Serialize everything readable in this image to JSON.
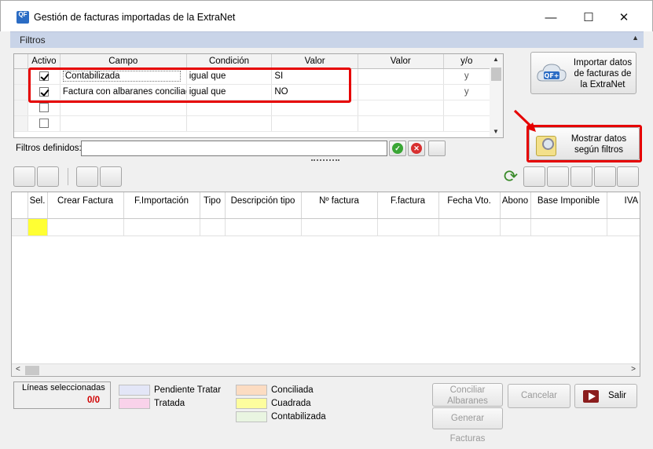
{
  "window": {
    "app_icon": "QF",
    "title": "Gestión de facturas importadas de la ExtraNet",
    "controls": {
      "minimize": "—",
      "maximize": "☐",
      "close": "✕"
    }
  },
  "filters_panel": {
    "label": "Filtros",
    "columns": [
      "Activo",
      "Campo",
      "Condición",
      "Valor",
      "Valor",
      "y/o"
    ],
    "rows": [
      {
        "active": true,
        "field": "Contabilizada",
        "condition": "igual que",
        "value1": "SI",
        "value2": "",
        "andor": "y"
      },
      {
        "active": true,
        "field": "Factura con albaranes conciliados",
        "condition": "igual que",
        "value1": "NO",
        "value2": "",
        "andor": "y"
      },
      {
        "active": false,
        "field": "",
        "condition": "",
        "value1": "",
        "value2": "",
        "andor": ""
      },
      {
        "active": false,
        "field": "",
        "condition": "",
        "value1": "",
        "value2": "",
        "andor": ""
      },
      {
        "active": false,
        "field": "",
        "condition": "",
        "value1": "",
        "value2": "",
        "andor": ""
      }
    ],
    "defined_filters_label": "Filtros definidos:",
    "defined_filters_value": ""
  },
  "buttons": {
    "import": "Importar datos de facturas de la ExtraNet",
    "show": "Mostrar datos según filtros",
    "conciliar": "Conciliar Albaranes",
    "generar": "Generar Facturas",
    "cancelar": "Cancelar",
    "salir": "Salir"
  },
  "main_grid": {
    "columns": [
      "",
      "Sel.",
      "Crear Factura",
      "F.Importación",
      "Tipo",
      "Descripción tipo",
      "Nº factura",
      "F.factura",
      "Fecha Vto.",
      "Abono",
      "Base Imponible",
      "IVA"
    ]
  },
  "selection": {
    "label": "Líneas seleccionadas",
    "value": "0/0"
  },
  "legend": [
    {
      "label": "Pendiente Tratar",
      "color": "#e3e6f7"
    },
    {
      "label": "Tratada",
      "color": "#f9d2ea"
    },
    {
      "label": "Conciliada",
      "color": "#fcdcc2"
    },
    {
      "label": "Cuadrada",
      "color": "#fdfd9e"
    },
    {
      "label": "Contabilizada",
      "color": "#e9f5e1"
    }
  ],
  "colors": {
    "highlight": "#e60000",
    "selected_cell": "#ffff33",
    "header_band": "#c9d4e8"
  }
}
